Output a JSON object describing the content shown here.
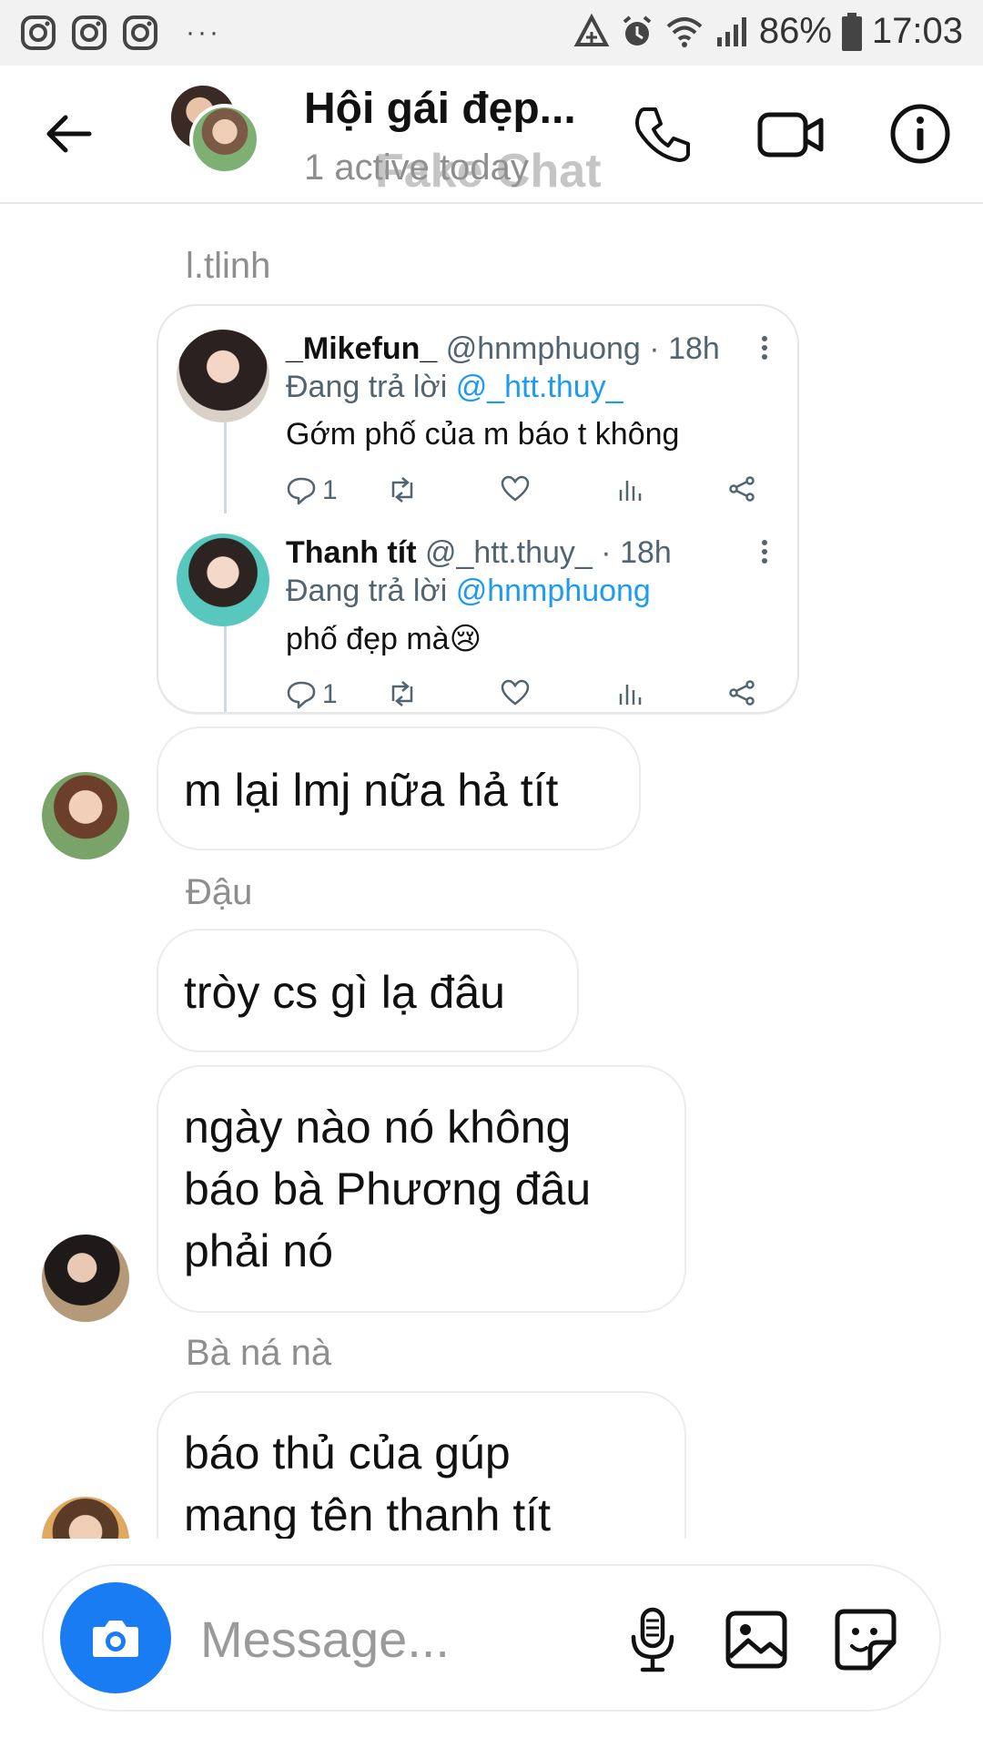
{
  "status_bar": {
    "battery": "86%",
    "time": "17:03",
    "overflow": "···"
  },
  "header": {
    "title": "Hội gái đẹp...",
    "subtitle": "1 active today",
    "watermark": "Fake Chat"
  },
  "messages": {
    "shared_sender": "l.tlinh",
    "tweet": {
      "first": {
        "name": "_Mikefun_",
        "handle": "@hnmphuong",
        "dot": "·",
        "time": "18h",
        "reply_prefix": "Đang trả lời",
        "reply_to": "@_htt.thuy_",
        "text": "Gớm phố của m báo t không",
        "replies": "1"
      },
      "second": {
        "name": "Thanh tít",
        "handle": "@_htt.thuy_",
        "dot": "·",
        "time": "18h",
        "reply_prefix": "Đang trả lời",
        "reply_to": "@hnmphuong",
        "text": "phố đẹp mà😢",
        "replies": "1"
      }
    },
    "msg1": "m lại lmj nữa hả tít",
    "sender2": "Đậu",
    "msg2": "tròy cs gì lạ đâu",
    "msg3_line1": "ngày nào nó không",
    "msg3_line2": "báo bà Phương đâu",
    "msg3_line3": "phải nó",
    "sender3": "Bà ná nà",
    "msg4_line1": "báo thủ của gúp",
    "msg4_line2": "mang tên thanh tít"
  },
  "composer": {
    "placeholder": "Message..."
  },
  "colors": {
    "accent": "#1a7cf2",
    "mention": "#1d9bf0",
    "muted": "#8e8e8e"
  }
}
